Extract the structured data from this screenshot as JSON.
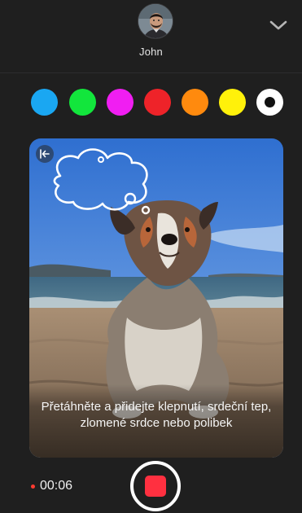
{
  "header": {
    "contact_name": "John",
    "collapse_icon": "chevron-down-icon"
  },
  "palette": {
    "colors": [
      "#1aa7f2",
      "#12e63c",
      "#f01ef2",
      "#ee2329",
      "#ff8a0e",
      "#fff10a",
      "#ffffff"
    ],
    "selected_index": 6
  },
  "canvas": {
    "back_icon": "collapse-left-icon",
    "hint": "Přetáhněte a přidejte klepnutí, srdeční tep, zlomené srdce nebo polibek"
  },
  "footer": {
    "timer": "00:06",
    "record_icon": "stop-recording-icon"
  }
}
